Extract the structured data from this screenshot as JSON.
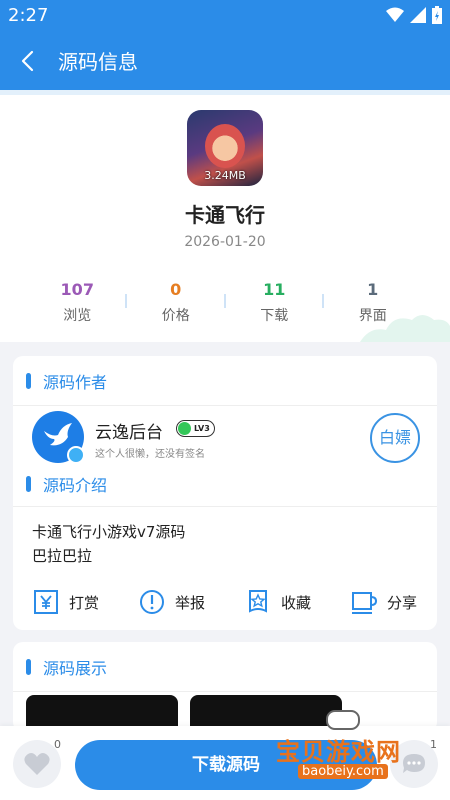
{
  "status_bar": {
    "time": "2:27"
  },
  "app_bar": {
    "title": "源码信息"
  },
  "header": {
    "icon_size_label": "3.24MB",
    "name": "卡通飞行",
    "date": "2026-01-20",
    "stats": [
      {
        "value": "107",
        "label": "浏览",
        "color": "#9b59b6"
      },
      {
        "value": "0",
        "label": "价格",
        "color": "#e67e22"
      },
      {
        "value": "11",
        "label": "下载",
        "color": "#27ae60"
      },
      {
        "value": "1",
        "label": "界面",
        "color": "#5b6b7b"
      }
    ]
  },
  "author_section": {
    "title": "源码作者",
    "name": "云逸后台",
    "level": "LV3",
    "signature": "这个人很懒，还没有签名",
    "follow_label": "白嫖"
  },
  "intro_section": {
    "title": "源码介绍",
    "lines": [
      "卡通飞行小游戏v7源码",
      "巴拉巴拉"
    ]
  },
  "actions": [
    {
      "label": "打赏",
      "icon": "yen-icon"
    },
    {
      "label": "举报",
      "icon": "warning-icon"
    },
    {
      "label": "收藏",
      "icon": "bookmark-star-icon"
    },
    {
      "label": "分享",
      "icon": "cup-icon"
    }
  ],
  "showcase_section": {
    "title": "源码展示"
  },
  "bottom_bar": {
    "like_count": "0",
    "download_label": "下载源码",
    "comment_count": "1"
  },
  "watermark": {
    "title": "宝贝游戏网",
    "url": "baobeiy.com"
  },
  "colors": {
    "primary": "#2b8ce8",
    "background": "#f2f3f7"
  }
}
